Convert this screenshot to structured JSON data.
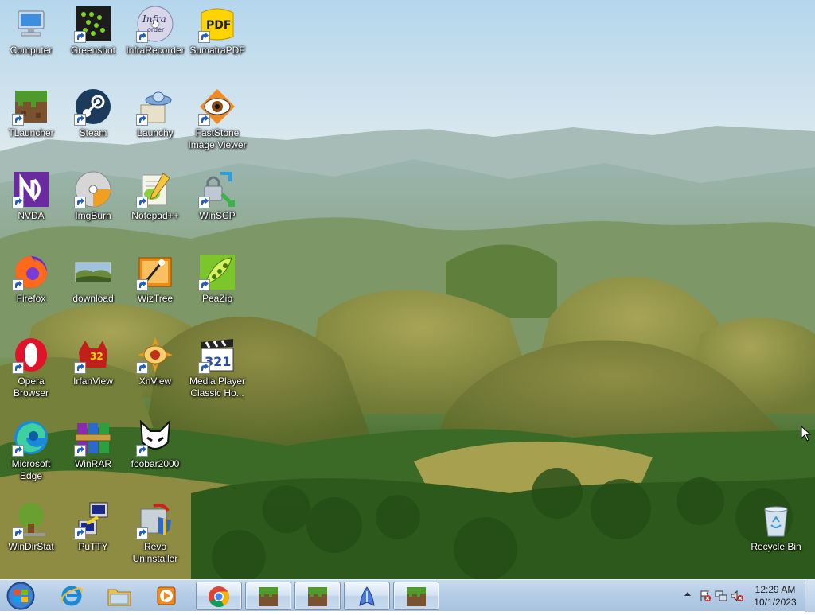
{
  "desktop": {
    "icons": [
      {
        "label": "Computer"
      },
      {
        "label": "Greenshot"
      },
      {
        "label": "InfraRecorder"
      },
      {
        "label": "SumatraPDF"
      },
      {
        "label": "TLauncher"
      },
      {
        "label": "Steam"
      },
      {
        "label": "Launchy"
      },
      {
        "label": "FastStone Image Viewer"
      },
      {
        "label": "NVDA"
      },
      {
        "label": "ImgBurn"
      },
      {
        "label": "Notepad++"
      },
      {
        "label": "WinSCP"
      },
      {
        "label": "Firefox"
      },
      {
        "label": "download"
      },
      {
        "label": "WizTree"
      },
      {
        "label": "PeaZip"
      },
      {
        "label": "Opera Browser"
      },
      {
        "label": "IrfanView"
      },
      {
        "label": "XnView"
      },
      {
        "label": "Media Player Classic Ho..."
      },
      {
        "label": "Microsoft Edge"
      },
      {
        "label": "WinRAR"
      },
      {
        "label": "foobar2000"
      },
      {
        "label": "WinDirStat"
      },
      {
        "label": "PuTTY"
      },
      {
        "label": "Revo Uninstaller"
      },
      {
        "label": "Recycle Bin"
      }
    ]
  },
  "taskbar": {
    "start_icon": "windows-orb-icon",
    "pinned": [
      "internet-explorer-icon",
      "file-explorer-icon",
      "media-player-icon"
    ],
    "buttons": [
      "chrome-icon",
      "minecraft-grass-icon",
      "minecraft-grass-icon",
      "launchy-ship-icon",
      "minecraft-grass-icon"
    ],
    "tray": {
      "icons": [
        "show-hidden-icons-chevron",
        "action-center-flag-icon",
        "network-icon",
        "volume-muted-icon"
      ],
      "time": "12:29 AM",
      "date": "10/1/2023"
    }
  }
}
